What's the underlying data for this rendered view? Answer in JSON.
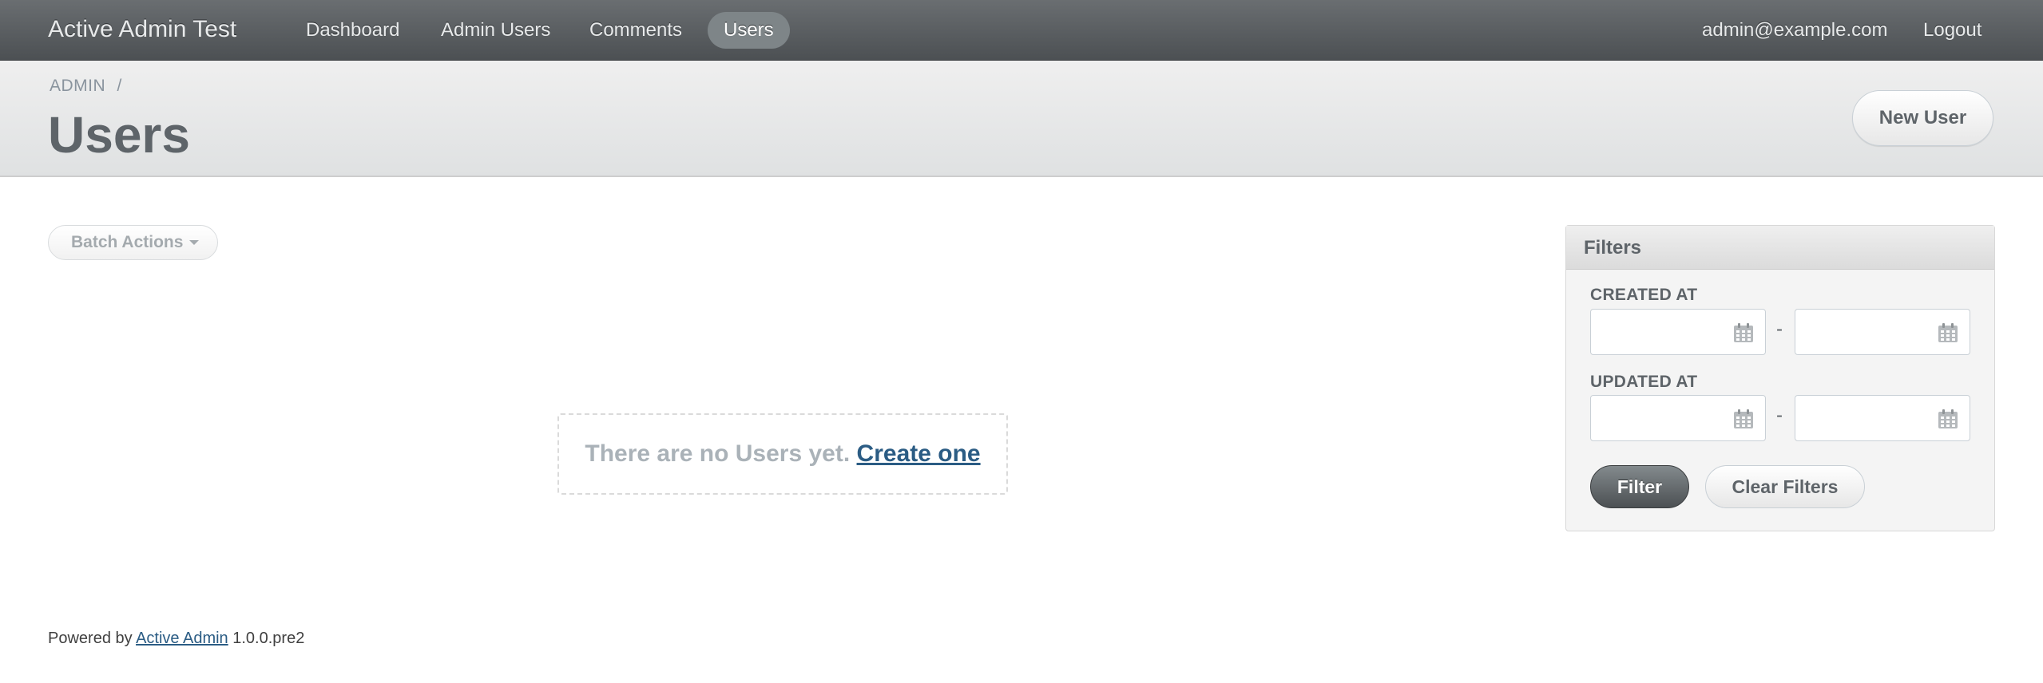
{
  "header": {
    "site_title": "Active Admin Test",
    "nav": [
      "Dashboard",
      "Admin Users",
      "Comments",
      "Users"
    ],
    "current_nav": "Users",
    "user_email": "admin@example.com",
    "logout_label": "Logout"
  },
  "title_bar": {
    "breadcrumb": "ADMIN",
    "breadcrumb_sep": "/",
    "page_title": "Users",
    "action_label": "New User"
  },
  "main": {
    "batch_actions_label": "Batch Actions",
    "blank_slate_text": "There are no Users yet.",
    "blank_slate_link": "Create one"
  },
  "filters": {
    "title": "Filters",
    "fields": [
      {
        "label": "CREATED AT",
        "separator": "-"
      },
      {
        "label": "UPDATED AT",
        "separator": "-"
      }
    ],
    "filter_button": "Filter",
    "clear_button": "Clear Filters"
  },
  "footer": {
    "prefix": "Powered by",
    "link": "Active Admin",
    "version": "1.0.0.pre2"
  },
  "colors": {
    "header_bg": "#5a5e61",
    "link": "#2b5c84",
    "text": "#5e6469"
  }
}
